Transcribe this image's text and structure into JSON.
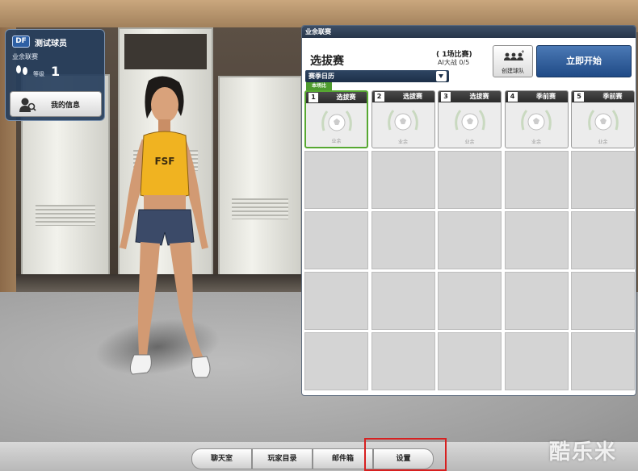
{
  "player_card": {
    "position": "DF",
    "name": "测试球员",
    "league": "业余联赛",
    "level_label": "等级",
    "level": "1",
    "my_info_label": "我的信息"
  },
  "panel": {
    "header": "业余联赛",
    "mode_title": "选拔赛",
    "match_count": "( 1场比赛)",
    "ai_count": "AI大战 0/5",
    "create_team_label": "创建球队",
    "start_label": "立即开始",
    "calendar_label": "赛季日历",
    "current_tag": "本场比",
    "matches": [
      {
        "num": "1",
        "type": "选拔赛",
        "status": "业余"
      },
      {
        "num": "2",
        "type": "选拔赛",
        "status": "业余"
      },
      {
        "num": "3",
        "type": "选拔赛",
        "status": "业余"
      },
      {
        "num": "4",
        "type": "季前赛",
        "status": "业余"
      },
      {
        "num": "5",
        "type": "季前赛",
        "status": "业余"
      }
    ]
  },
  "bottom_menu": {
    "chat": "聊天室",
    "player_list": "玩家目录",
    "mailbox": "邮件箱",
    "settings": "设置"
  },
  "watermark": "酷乐米",
  "colors": {
    "start_button": "#2d5c9c",
    "active_match_border": "#57a832",
    "highlight_box": "#d72020"
  }
}
